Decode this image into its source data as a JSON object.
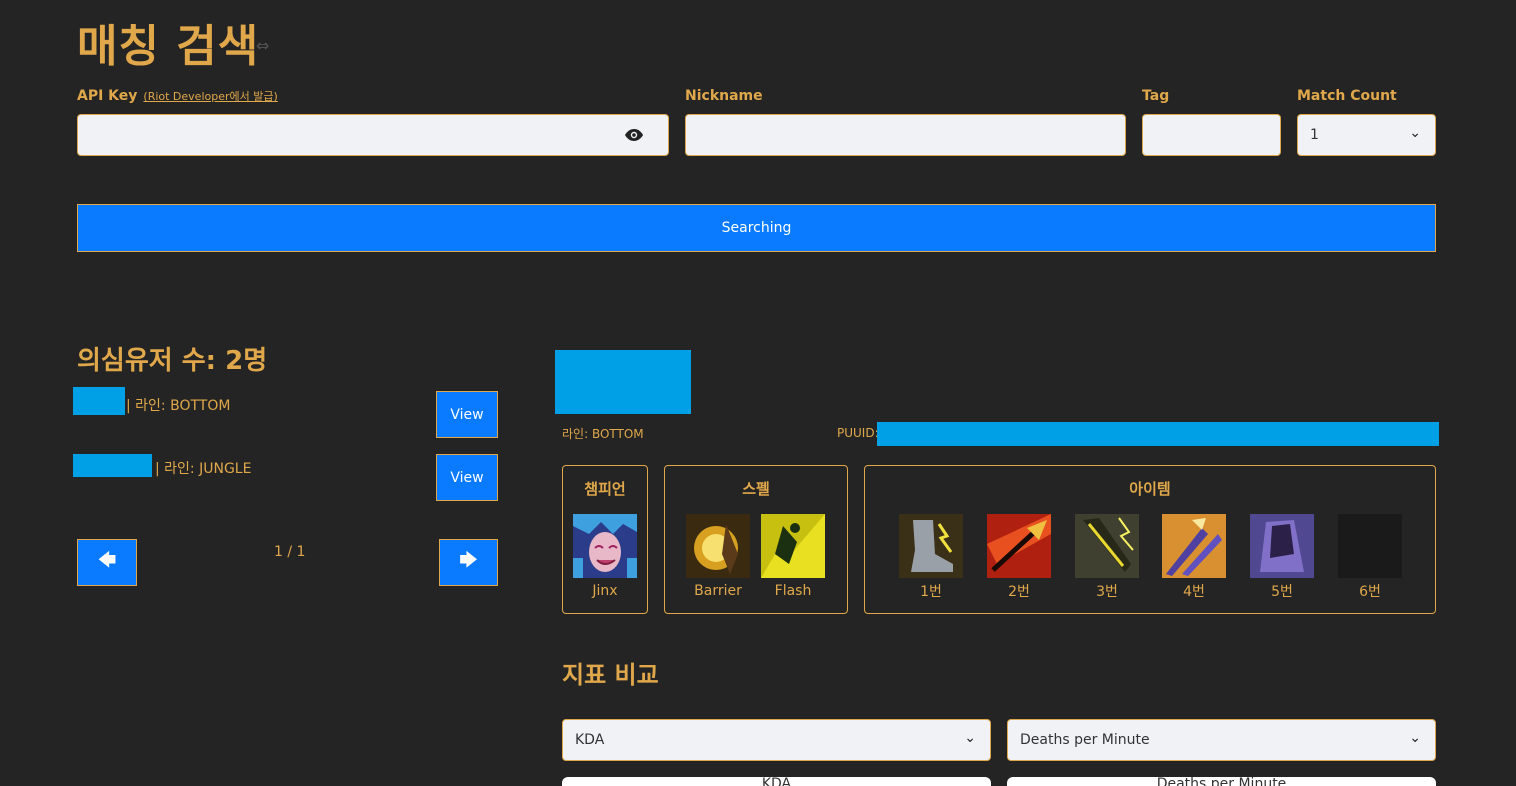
{
  "header": {
    "title": "매칭 검색",
    "link_icon": "link-icon"
  },
  "form": {
    "api_key_label": "API Key",
    "api_key_hint": "(Riot Developer에서 발급)",
    "api_key_value": "",
    "nickname_label": "Nickname",
    "nickname_value": "",
    "tag_label": "Tag",
    "tag_value": "",
    "match_count_label": "Match Count",
    "match_count_value": "1",
    "search_button": "Searching"
  },
  "suspects": {
    "title": "의심유저 수: 2명",
    "items": [
      {
        "lane_text": "| 라인: BOTTOM",
        "view": "View"
      },
      {
        "lane_text": "| 라인: JUNGLE",
        "view": "View"
      }
    ],
    "pagination": "1 / 1",
    "prev_icon": "arrow-left-icon",
    "next_icon": "arrow-right-icon"
  },
  "detail": {
    "lane": "라인: BOTTOM",
    "puuid_label": "PUUID:",
    "champion_title": "챔피언",
    "champion_name": "Jinx",
    "spell_title": "스펠",
    "spells": [
      "Barrier",
      "Flash"
    ],
    "item_title": "아이템",
    "items": [
      "1번",
      "2번",
      "3번",
      "4번",
      "5번",
      "6번"
    ]
  },
  "compare": {
    "title": "지표 비교",
    "left_select": "KDA",
    "right_select": "Deaths per Minute",
    "left_card_title": "KDA",
    "right_card_title": "Deaths per Minute"
  },
  "colors": {
    "accent": "#e0a84a",
    "button": "#0a7bff",
    "background": "#242424",
    "redaction": "#00a0e6"
  }
}
